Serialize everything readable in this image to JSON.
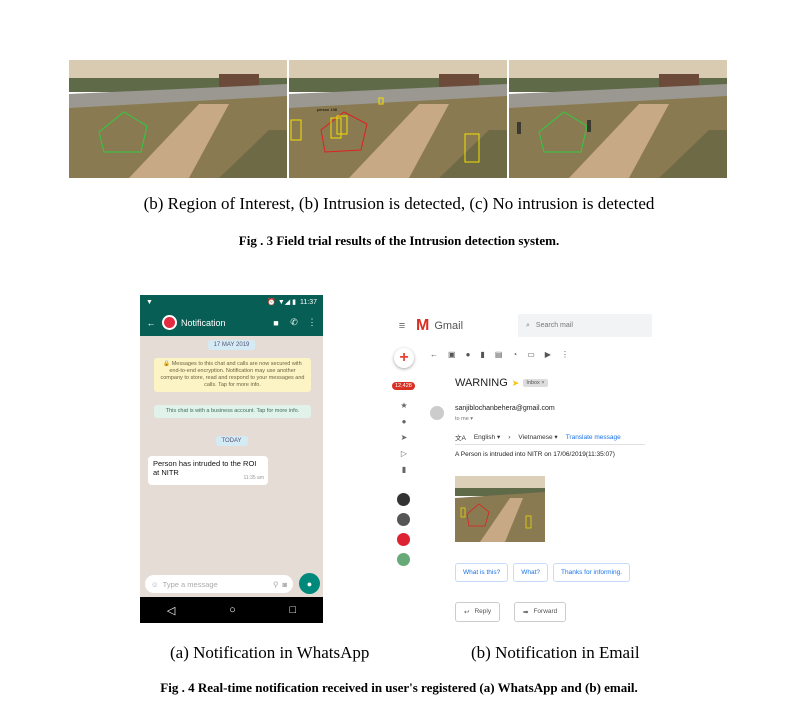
{
  "fig3": {
    "images": [
      {
        "id": "a",
        "boxes": 0
      },
      {
        "id": "b",
        "box_label": "person 198"
      },
      {
        "id": "c",
        "boxes": 0
      }
    ],
    "subcaption": "(b) Region of Interest, (b) Intrusion is detected, (c) No intrusion is detected",
    "caption": "Fig . 3  Field trial results of the Intrusion detection system."
  },
  "whatsapp": {
    "status_time": "11:37",
    "status_icons": "⏰ ▼◢ ▮",
    "header_title": "Notification",
    "date_pill": "17 MAY 2019",
    "encryption_note": "🔒 Messages to this chat and calls are now secured with end-to-end encryption. Notification may use another company to store, read and respond to your messages and calls. Tap for more info.",
    "business_note": "This chat is with a business account. Tap for more info.",
    "today_pill": "TODAY",
    "message": "Person has intruded to the ROI at NITR",
    "message_time": "11:35 am",
    "input_placeholder": "Type a message"
  },
  "gmail": {
    "product": "Gmail",
    "search_placeholder": "Search mail",
    "unread_count": "12,428",
    "subject": "WARNING",
    "label": "Inbox ×",
    "from": "sanjiblochanbehera@gmail.com",
    "to": "to me ▾",
    "translate_from": "English ▾",
    "translate_to": "Vietnamese ▾",
    "translate_link": "Translate message",
    "body": "A Person is intruded into NITR on 17/06/2019(11:35:07)",
    "smart_replies": [
      "What is this?",
      "What?",
      "Thanks for informing."
    ],
    "reply": "Reply",
    "forward": "Forward"
  },
  "fig4": {
    "sub_a": "(a) Notification in WhatsApp",
    "sub_b": "(b) Notification in Email",
    "caption": "Fig . 4  Real-time notification received in user's registered (a) WhatsApp and (b) email."
  }
}
